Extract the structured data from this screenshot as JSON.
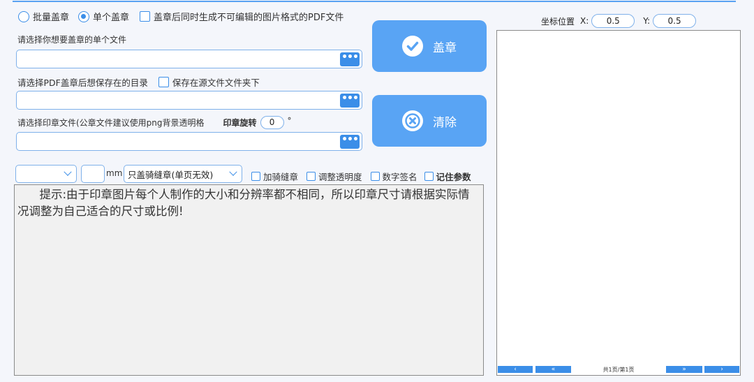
{
  "mode": {
    "batch_label": "批量盖章",
    "single_label": "单个盖章",
    "pdf_image_label": "盖章后同时生成不可编辑的图片格式的PDF文件"
  },
  "file": {
    "label": "请选择你想要盖章的单个文件",
    "value": "",
    "browse_label": "•••"
  },
  "output": {
    "label": "请选择PDF盖章后想保存在的目录",
    "save_source_label": "保存在源文件文件夹下",
    "value": "",
    "browse_label": "•••"
  },
  "stamp": {
    "label": "请选择印章文件(公章文件建议使用png背景透明格",
    "rotate_label": "印章旋转",
    "rotate_value": "0",
    "degree_symbol": "°",
    "value": "",
    "browse_label": "•••"
  },
  "actions": {
    "stamp_label": "盖章",
    "clear_label": "清除"
  },
  "options": {
    "size_value": "",
    "mm_value": "",
    "mm_unit": "mm",
    "seam_select": "只盖骑缝章(单页无效)",
    "add_seam_label": "加骑缝章",
    "adjust_opacity_label": "调整透明度",
    "digital_sign_label": "数字签名",
    "remember_label": "记住参数"
  },
  "tip": {
    "text": "      提示:由于印章图片每个人制作的大小和分辨率都不相同，所以印章尺寸请根据实际情况调整为自己适合的尺寸或比例!"
  },
  "coords": {
    "label": "坐标位置",
    "x_label": "X:",
    "x_value": "0.5",
    "y_label": "Y:",
    "y_value": "0.5"
  },
  "pager": {
    "prev": "‹",
    "first": "«",
    "page_info": "共1页/第1页",
    "last": "»",
    "next": "›"
  },
  "colors": {
    "accent": "#3b8ee8",
    "button": "#59a4f4"
  }
}
